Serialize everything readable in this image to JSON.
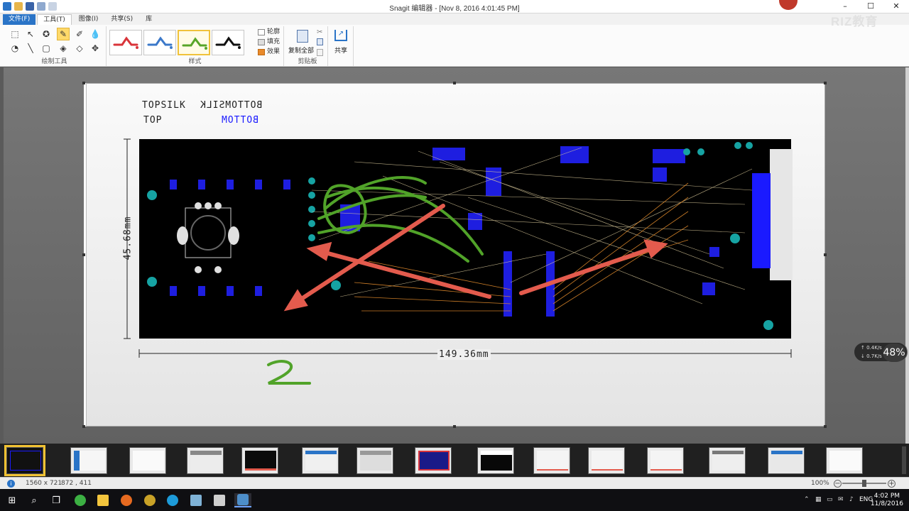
{
  "window": {
    "title": "Snagit 编辑器 - [Nov 8, 2016 4:01:45 PM]",
    "controls": [
      "–",
      "☐",
      "✕"
    ]
  },
  "watermark": "RIZ教育",
  "ribbon": {
    "tabs": [
      {
        "label": "文件(F)"
      },
      {
        "label": "工具(T)"
      },
      {
        "label": "图像(I)"
      },
      {
        "label": "共享(S)"
      },
      {
        "label": "库"
      }
    ],
    "groups": {
      "drawing_tools": "绘制工具",
      "styles": "样式",
      "clipboard": "剪贴板"
    },
    "properties": {
      "outline": "轮廓",
      "fill": "填充",
      "effects": "效果"
    },
    "copy_all": "复制全部",
    "share": "共享",
    "style_colors": [
      "#d9343a",
      "#3b78c9",
      "#58a529",
      "#111111"
    ]
  },
  "canvas": {
    "silk_top": "TOPSILK",
    "silk_bottom_mirror": "BOTTOMSILK",
    "layer_top": "TOP",
    "layer_bottom_mirror": "BOTTOM",
    "dim_height": "45.68mm",
    "dim_width": "149.36mm",
    "annotation": "2"
  },
  "status": {
    "dimensions": "1560 x 721",
    "cursor": "872 , 411",
    "zoom": "100%"
  },
  "netmon": {
    "up": "↑ 0.4K/s",
    "down": "↓ 0.7K/s",
    "cpu": "48%"
  },
  "taskbar": {
    "lang": "ENG",
    "time": "4:02 PM",
    "date": "11/8/2016"
  }
}
